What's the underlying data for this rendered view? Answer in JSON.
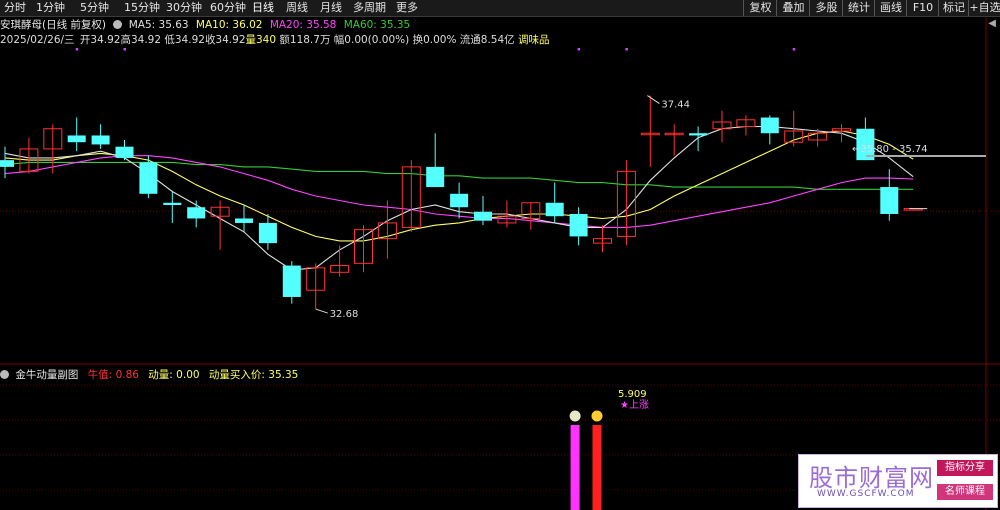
{
  "toolbar": {
    "periods": [
      "分时",
      "1分钟",
      "5分钟",
      "15分钟",
      "30分钟",
      "60分钟",
      "日线",
      "周线",
      "月线",
      "多周期",
      "更多"
    ],
    "active_period": "日线",
    "right_buttons": [
      "复权",
      "叠加",
      "多股",
      "统计",
      "画线",
      "F10",
      "标记",
      "+自选"
    ]
  },
  "header": {
    "stock_name": "安琪酵母(日线 前复权)",
    "ma5": "MA5: 35.63",
    "ma10": "MA10: 36.02",
    "ma20": "MA20: 35.58",
    "ma60": "MA60: 35.35",
    "date": "2025/02/26/三",
    "open": "开34.92",
    "high": "高34.92",
    "low": "低34.92",
    "close": "收34.92",
    "volume": "量340",
    "amount": "额118.7万",
    "amplitude": "幅0.00(0.00%)",
    "turnover": "换0.00%",
    "float_value": "流通8.54亿",
    "sector": "调味品"
  },
  "sub_header": {
    "title": "金牛动量副图",
    "niuzhi": "牛值: 0.86",
    "dongliang": "动量: 0.00",
    "buy_price": "动量买入价: 35.35"
  },
  "colors": {
    "up": "#ff3232",
    "down": "#54ffff",
    "ma5": "#e0e0e0",
    "ma10": "#ffff66",
    "ma20": "#ff44ff",
    "ma60": "#33cc33",
    "magenta_bar": "#ff33ff",
    "red_bar": "#ff2020"
  },
  "chart_data": {
    "type": "candlestick",
    "y_range": [
      31.5,
      38.5
    ],
    "annotations": {
      "high_label": "37.44",
      "low_label": "32.68",
      "range_label": "35.80 - 35.74",
      "signal_value": "5.909",
      "signal_text": "★上涨"
    },
    "candles": [
      {
        "o": 36.0,
        "h": 36.3,
        "l": 35.6,
        "c": 35.85
      },
      {
        "o": 35.75,
        "h": 36.5,
        "l": 35.7,
        "c": 36.25
      },
      {
        "o": 36.25,
        "h": 36.8,
        "l": 35.7,
        "c": 36.7
      },
      {
        "o": 36.55,
        "h": 36.95,
        "l": 36.2,
        "c": 36.4
      },
      {
        "o": 36.55,
        "h": 36.8,
        "l": 36.25,
        "c": 36.35
      },
      {
        "o": 36.3,
        "h": 36.45,
        "l": 36.0,
        "c": 36.05
      },
      {
        "o": 35.95,
        "h": 36.1,
        "l": 35.15,
        "c": 35.25
      },
      {
        "o": 35.05,
        "h": 35.3,
        "l": 34.6,
        "c": 35.0
      },
      {
        "o": 34.95,
        "h": 35.1,
        "l": 34.5,
        "c": 34.7
      },
      {
        "o": 34.75,
        "h": 35.1,
        "l": 34.0,
        "c": 34.95
      },
      {
        "o": 34.7,
        "h": 35.0,
        "l": 34.4,
        "c": 34.6
      },
      {
        "o": 34.6,
        "h": 34.8,
        "l": 34.0,
        "c": 34.15
      },
      {
        "o": 33.65,
        "h": 33.75,
        "l": 32.8,
        "c": 32.95
      },
      {
        "o": 33.1,
        "h": 33.7,
        "l": 32.68,
        "c": 33.6
      },
      {
        "o": 33.5,
        "h": 34.1,
        "l": 33.4,
        "c": 33.65
      },
      {
        "o": 33.7,
        "h": 34.55,
        "l": 33.5,
        "c": 34.45
      },
      {
        "o": 34.25,
        "h": 35.1,
        "l": 33.8,
        "c": 34.6
      },
      {
        "o": 34.5,
        "h": 36.0,
        "l": 34.4,
        "c": 35.85
      },
      {
        "o": 35.85,
        "h": 36.6,
        "l": 35.4,
        "c": 35.4
      },
      {
        "o": 35.25,
        "h": 35.5,
        "l": 34.7,
        "c": 34.95
      },
      {
        "o": 34.85,
        "h": 35.2,
        "l": 34.55,
        "c": 34.65
      },
      {
        "o": 34.6,
        "h": 35.1,
        "l": 34.5,
        "c": 34.75
      },
      {
        "o": 34.7,
        "h": 35.05,
        "l": 34.45,
        "c": 35.05
      },
      {
        "o": 35.05,
        "h": 35.5,
        "l": 34.6,
        "c": 34.75
      },
      {
        "o": 34.8,
        "h": 34.95,
        "l": 34.1,
        "c": 34.3
      },
      {
        "o": 34.15,
        "h": 34.55,
        "l": 33.95,
        "c": 34.25
      },
      {
        "o": 34.3,
        "h": 36.0,
        "l": 34.1,
        "c": 35.75
      },
      {
        "o": 36.6,
        "h": 37.44,
        "l": 35.85,
        "c": 36.6
      },
      {
        "o": 36.6,
        "h": 36.8,
        "l": 36.1,
        "c": 36.6
      },
      {
        "o": 36.6,
        "h": 36.75,
        "l": 36.2,
        "c": 36.55
      },
      {
        "o": 36.7,
        "h": 37.1,
        "l": 36.4,
        "c": 36.85
      },
      {
        "o": 36.75,
        "h": 37.0,
        "l": 36.55,
        "c": 36.9
      },
      {
        "o": 36.95,
        "h": 37.0,
        "l": 36.35,
        "c": 36.6
      },
      {
        "o": 36.4,
        "h": 37.1,
        "l": 36.3,
        "c": 36.65
      },
      {
        "o": 36.45,
        "h": 36.7,
        "l": 36.3,
        "c": 36.6
      },
      {
        "o": 36.65,
        "h": 36.8,
        "l": 36.4,
        "c": 36.7
      },
      {
        "o": 36.7,
        "h": 36.95,
        "l": 36.0,
        "c": 36.0
      },
      {
        "o": 35.4,
        "h": 35.8,
        "l": 34.65,
        "c": 34.8
      },
      {
        "o": 34.92,
        "h": 34.92,
        "l": 34.92,
        "c": 34.92
      }
    ],
    "ma5": [
      36.15,
      36.05,
      36.05,
      36.1,
      36.2,
      36.05,
      35.7,
      35.3,
      35.0,
      34.7,
      34.4,
      33.9,
      33.55,
      33.6,
      34.0,
      34.3,
      34.65,
      34.9,
      35.0,
      34.85,
      34.8,
      34.8,
      34.7,
      34.6,
      34.5,
      34.5,
      34.9,
      35.55,
      36.05,
      36.5,
      36.7,
      36.75,
      36.75,
      36.7,
      36.65,
      36.6,
      36.4,
      36.05,
      35.63
    ],
    "ma10": [
      36.05,
      36.0,
      36.0,
      36.1,
      36.15,
      36.1,
      36.0,
      35.75,
      35.45,
      35.2,
      35.0,
      34.75,
      34.5,
      34.3,
      34.2,
      34.2,
      34.3,
      34.45,
      34.55,
      34.6,
      34.7,
      34.75,
      34.8,
      34.8,
      34.75,
      34.7,
      34.75,
      34.9,
      35.2,
      35.45,
      35.7,
      35.95,
      36.2,
      36.45,
      36.6,
      36.65,
      36.55,
      36.35,
      36.02
    ],
    "ma20": [
      35.7,
      35.75,
      35.85,
      35.95,
      36.05,
      36.1,
      36.1,
      36.05,
      35.95,
      35.85,
      35.7,
      35.55,
      35.35,
      35.2,
      35.1,
      35.0,
      34.95,
      34.9,
      34.8,
      34.75,
      34.7,
      34.7,
      34.65,
      34.6,
      34.55,
      34.5,
      34.5,
      34.55,
      34.65,
      34.75,
      34.85,
      34.95,
      35.05,
      35.2,
      35.35,
      35.5,
      35.6,
      35.6,
      35.58
    ],
    "ma60": [
      35.9,
      35.95,
      35.95,
      35.95,
      35.95,
      35.95,
      35.95,
      35.95,
      35.9,
      35.9,
      35.85,
      35.85,
      35.8,
      35.75,
      35.75,
      35.75,
      35.7,
      35.7,
      35.65,
      35.65,
      35.6,
      35.6,
      35.6,
      35.55,
      35.5,
      35.5,
      35.45,
      35.45,
      35.4,
      35.4,
      35.4,
      35.4,
      35.4,
      35.4,
      35.35,
      35.35,
      35.35,
      35.35,
      35.35
    ],
    "signal_bars": [
      {
        "index": 24,
        "color": "magenta",
        "value": 5.909
      },
      {
        "index": 25,
        "color": "red",
        "value": 5.909
      }
    ]
  },
  "logo": {
    "brand": "股市财富网",
    "url": "WWW.GSCFW.COM",
    "tag1": "指标分享",
    "tag2": "名师课程"
  }
}
